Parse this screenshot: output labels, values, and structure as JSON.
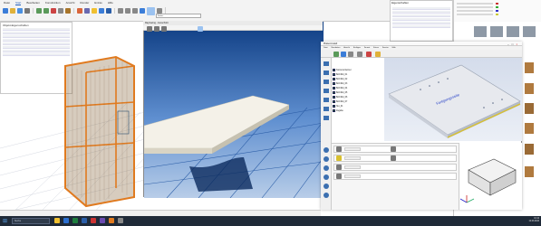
{
  "ribbon": {
    "tabs": [
      "Datei",
      "Start",
      "Bearbeiten",
      "Konstruktion",
      "Ansicht",
      "Render",
      "Extras",
      "Hilfe"
    ],
    "active_tab": "Start",
    "tool_labels": [
      "Neu",
      "Öffnen",
      "Speichern",
      "Drucken",
      "Rückgängig",
      "Wiederholen",
      "Ausschneiden",
      "Kopieren",
      "Einfügen",
      "Messen",
      "Raster",
      "Licht",
      "Kamera",
      "Rendern"
    ],
    "search_placeholder": "Suche..."
  },
  "left_panel": {
    "title": "Objekt-Eigenschaften"
  },
  "render_window": {
    "title": "Raytracing - Ausschnitt"
  },
  "prop_panel": {
    "title": "Eigenschaften"
  },
  "subwindow": {
    "title": "Plattenmodell",
    "menu": [
      "Datei",
      "Bearbeiten",
      "Ansicht",
      "Einfügen",
      "Format",
      "Extras",
      "Fenster",
      "Hilfe"
    ],
    "tree": [
      "Kantenumleimer",
      "Bohrbild_01",
      "Bohrbild_02",
      "Bohrbild_03",
      "Bohrbild_04",
      "Bohrbild_05",
      "Bohrbild_06",
      "Bohrbild_07",
      "Nut_01",
      "Zugabe"
    ],
    "annotation": "Fertigungsseite"
  },
  "taskbar": {
    "search_placeholder": "Suche",
    "time": "10:42",
    "date": "12.03.2024"
  },
  "colors": {
    "accent": "#1f5fbf",
    "render_bg": "#1b4c8f",
    "frame_orange": "#e07a1f"
  }
}
